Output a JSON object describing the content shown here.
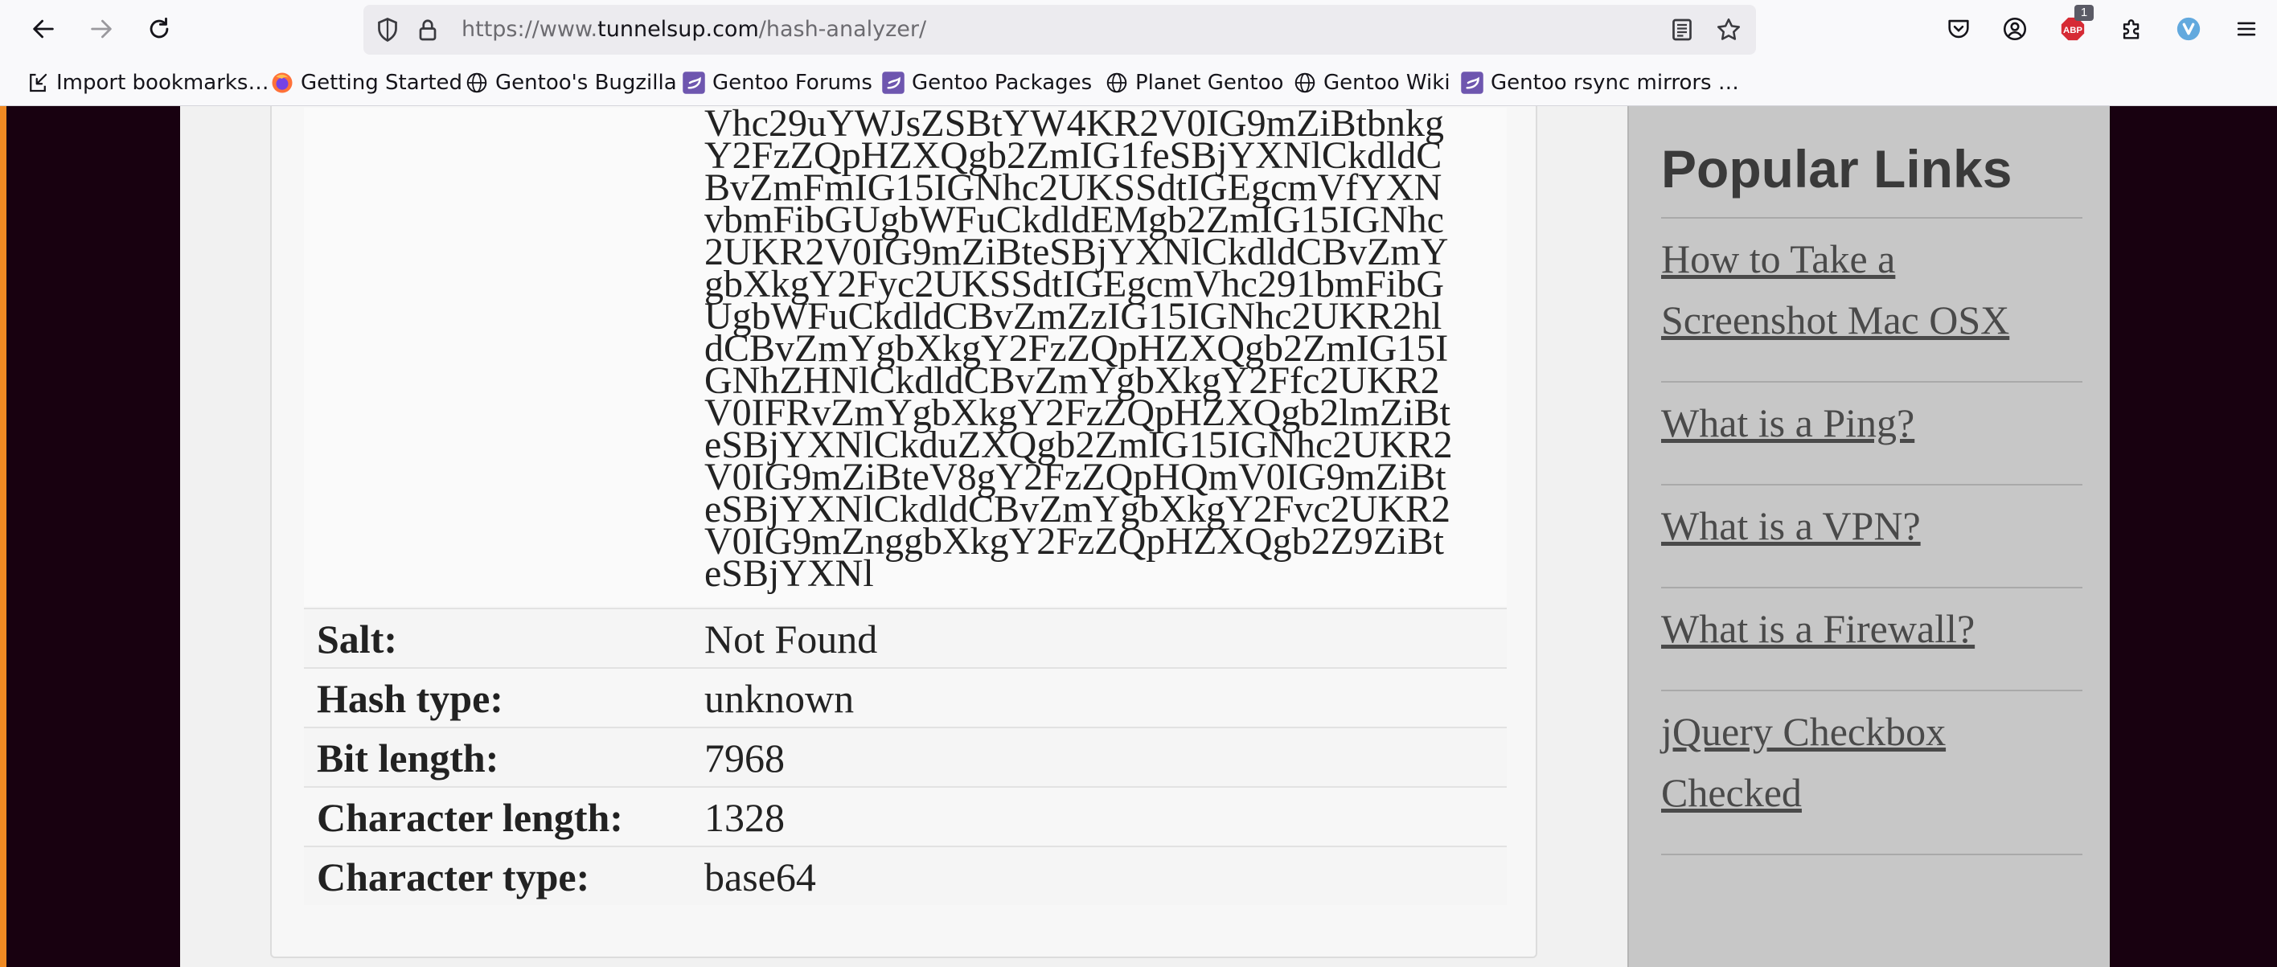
{
  "browser": {
    "url_prefix": "https://www.",
    "url_host": "tunnelsup.com",
    "url_path": "/hash-analyzer/",
    "extension_badge": "1",
    "adblock_label": "ABP",
    "bookmarks": [
      "Import bookmarks…",
      "Getting Started",
      "Gentoo's Bugzilla",
      "Gentoo Forums",
      "Gentoo Packages",
      "Planet Gentoo",
      "Gentoo Wiki",
      "Gentoo rsync mirrors …"
    ]
  },
  "analysis": {
    "hash_lines": [
      "Vhc29uYWJsZSBtYW4KR2V0IG9mZiBtbnkg",
      "Y2FzZQpHZXQgb2ZmIG1feSBjYXNlCkdldC",
      "BvZmFmIG15IGNhc2UKSSdtIGEgcmVfYXN",
      "vbmFibGUgbWFuCkdldEMgb2ZmIG15IGNhc",
      "2UKR2V0IG9mZiBteSBjYXNlCkdldCBvZmY",
      "gbXkgY2Fyc2UKSSdtIGEgcmVhc291bmFibG",
      "UgbWFuCkdldCBvZmZzIG15IGNhc2UKR2hl",
      "dCBvZmYgbXkgY2FzZQpHZXQgb2ZmIG15I",
      "GNhZHNlCkdldCBvZmYgbXkgY2Ffc2UKR2",
      "V0IFRvZmYgbXkgY2FzZQpHZXQgb2lmZiBt",
      "eSBjYXNlCkduZXQgb2ZmIG15IGNhc2UKR2",
      "V0IG9mZiBteV8gY2FzZQpHQmV0IG9mZiBt",
      "eSBjYXNlCkdldCBvZmYgbXkgY2Fvc2UKR2",
      "V0IG9mZnggbXkgY2FzZQpHZXQgb2Z9ZiBt",
      "eSBjYXNl"
    ],
    "rows": [
      {
        "label": "Salt:",
        "value": "Not Found"
      },
      {
        "label": "Hash type:",
        "value": "unknown"
      },
      {
        "label": "Bit length:",
        "value": "7968"
      },
      {
        "label": "Character length:",
        "value": "1328"
      },
      {
        "label": "Character type:",
        "value": "base64"
      }
    ]
  },
  "sidebar": {
    "title": "Popular Links",
    "links": [
      [
        "How to Take a ",
        "Screenshot Mac OSX"
      ],
      [
        "What is a Ping?"
      ],
      [
        "What is a VPN?"
      ],
      [
        "What is a Firewall?"
      ],
      [
        "jQuery Checkbox ",
        "Checked"
      ]
    ]
  },
  "colors": {
    "page_background": "#180110",
    "sidebar_background": "#c7c7c7",
    "card_background": "#f7f7f7",
    "link_color": "#4a4a4a",
    "focus_edge": "#f08a23"
  },
  "icons": {
    "back": "back-arrow-icon",
    "forward": "forward-arrow-icon",
    "reload": "reload-icon",
    "tracking": "shield-icon",
    "lock": "lock-icon",
    "reader": "reader-view-icon",
    "bookmark": "star-icon",
    "pocket": "pocket-icon",
    "account": "account-icon",
    "adblock": "adblock-plus-icon",
    "extensions": "puzzle-icon",
    "vivaldi": "extension-v-icon",
    "menu": "hamburger-menu-icon"
  }
}
